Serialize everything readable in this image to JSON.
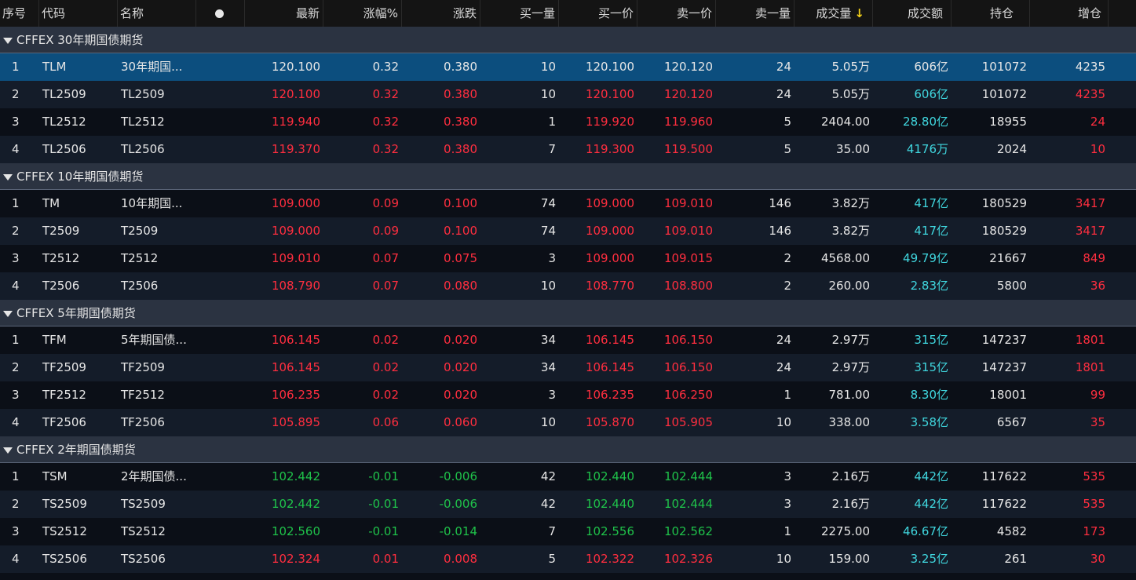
{
  "header": {
    "seq": "序号",
    "code": "代码",
    "name": "名称",
    "latest": "最新",
    "change_pct": "涨幅%",
    "change": "涨跌",
    "bid_vol": "买一量",
    "bid": "买一价",
    "ask": "卖一价",
    "ask_vol": "卖一量",
    "volume": "成交量",
    "sort_arrow": "↓",
    "turnover": "成交额",
    "oi": "持仓",
    "oi_change": "增仓"
  },
  "colors": {
    "up": "#ff2e3f",
    "down": "#1fc24a",
    "turnover": "#40d7df",
    "neutral": "#e6e6e6",
    "selected": "#0c4e7e"
  },
  "groups": [
    {
      "title": "CFFEX 30年期国债期货",
      "rows": [
        {
          "seq": "1",
          "code": "TLM",
          "name": "30年期国...",
          "latest": "120.100",
          "pct": "0.32",
          "chg": "0.380",
          "bidv": "10",
          "bid": "120.100",
          "ask": "120.120",
          "askv": "24",
          "vol": "5.05万",
          "amt": "606亿",
          "oi": "101072",
          "oic": "4235",
          "dir": "up",
          "oidir": "up",
          "selected": true
        },
        {
          "seq": "2",
          "code": "TL2509",
          "name": "TL2509",
          "latest": "120.100",
          "pct": "0.32",
          "chg": "0.380",
          "bidv": "10",
          "bid": "120.100",
          "ask": "120.120",
          "askv": "24",
          "vol": "5.05万",
          "amt": "606亿",
          "oi": "101072",
          "oic": "4235",
          "dir": "up",
          "oidir": "up"
        },
        {
          "seq": "3",
          "code": "TL2512",
          "name": "TL2512",
          "latest": "119.940",
          "pct": "0.32",
          "chg": "0.380",
          "bidv": "1",
          "bid": "119.920",
          "ask": "119.960",
          "askv": "5",
          "vol": "2404.00",
          "amt": "28.80亿",
          "oi": "18955",
          "oic": "24",
          "dir": "up",
          "oidir": "up"
        },
        {
          "seq": "4",
          "code": "TL2506",
          "name": "TL2506",
          "latest": "119.370",
          "pct": "0.32",
          "chg": "0.380",
          "bidv": "7",
          "bid": "119.300",
          "ask": "119.500",
          "askv": "5",
          "vol": "35.00",
          "amt": "4176万",
          "oi": "2024",
          "oic": "10",
          "dir": "up",
          "oidir": "up"
        }
      ]
    },
    {
      "title": "CFFEX 10年期国债期货",
      "rows": [
        {
          "seq": "1",
          "code": "TM",
          "name": "10年期国...",
          "latest": "109.000",
          "pct": "0.09",
          "chg": "0.100",
          "bidv": "74",
          "bid": "109.000",
          "ask": "109.010",
          "askv": "146",
          "vol": "3.82万",
          "amt": "417亿",
          "oi": "180529",
          "oic": "3417",
          "dir": "up",
          "oidir": "up"
        },
        {
          "seq": "2",
          "code": "T2509",
          "name": "T2509",
          "latest": "109.000",
          "pct": "0.09",
          "chg": "0.100",
          "bidv": "74",
          "bid": "109.000",
          "ask": "109.010",
          "askv": "146",
          "vol": "3.82万",
          "amt": "417亿",
          "oi": "180529",
          "oic": "3417",
          "dir": "up",
          "oidir": "up"
        },
        {
          "seq": "3",
          "code": "T2512",
          "name": "T2512",
          "latest": "109.010",
          "pct": "0.07",
          "chg": "0.075",
          "bidv": "3",
          "bid": "109.000",
          "ask": "109.015",
          "askv": "2",
          "vol": "4568.00",
          "amt": "49.79亿",
          "oi": "21667",
          "oic": "849",
          "dir": "up",
          "oidir": "up"
        },
        {
          "seq": "4",
          "code": "T2506",
          "name": "T2506",
          "latest": "108.790",
          "pct": "0.07",
          "chg": "0.080",
          "bidv": "10",
          "bid": "108.770",
          "ask": "108.800",
          "askv": "2",
          "vol": "260.00",
          "amt": "2.83亿",
          "oi": "5800",
          "oic": "36",
          "dir": "up",
          "oidir": "up"
        }
      ]
    },
    {
      "title": "CFFEX 5年期国债期货",
      "rows": [
        {
          "seq": "1",
          "code": "TFM",
          "name": "5年期国债...",
          "latest": "106.145",
          "pct": "0.02",
          "chg": "0.020",
          "bidv": "34",
          "bid": "106.145",
          "ask": "106.150",
          "askv": "24",
          "vol": "2.97万",
          "amt": "315亿",
          "oi": "147237",
          "oic": "1801",
          "dir": "up",
          "oidir": "up"
        },
        {
          "seq": "2",
          "code": "TF2509",
          "name": "TF2509",
          "latest": "106.145",
          "pct": "0.02",
          "chg": "0.020",
          "bidv": "34",
          "bid": "106.145",
          "ask": "106.150",
          "askv": "24",
          "vol": "2.97万",
          "amt": "315亿",
          "oi": "147237",
          "oic": "1801",
          "dir": "up",
          "oidir": "up"
        },
        {
          "seq": "3",
          "code": "TF2512",
          "name": "TF2512",
          "latest": "106.235",
          "pct": "0.02",
          "chg": "0.020",
          "bidv": "3",
          "bid": "106.235",
          "ask": "106.250",
          "askv": "1",
          "vol": "781.00",
          "amt": "8.30亿",
          "oi": "18001",
          "oic": "99",
          "dir": "up",
          "oidir": "up"
        },
        {
          "seq": "4",
          "code": "TF2506",
          "name": "TF2506",
          "latest": "105.895",
          "pct": "0.06",
          "chg": "0.060",
          "bidv": "10",
          "bid": "105.870",
          "ask": "105.905",
          "askv": "10",
          "vol": "338.00",
          "amt": "3.58亿",
          "oi": "6567",
          "oic": "35",
          "dir": "up",
          "oidir": "up"
        }
      ]
    },
    {
      "title": "CFFEX 2年期国债期货",
      "rows": [
        {
          "seq": "1",
          "code": "TSM",
          "name": "2年期国债...",
          "latest": "102.442",
          "pct": "-0.01",
          "chg": "-0.006",
          "bidv": "42",
          "bid": "102.440",
          "ask": "102.444",
          "askv": "3",
          "vol": "2.16万",
          "amt": "442亿",
          "oi": "117622",
          "oic": "535",
          "dir": "down",
          "oidir": "up"
        },
        {
          "seq": "2",
          "code": "TS2509",
          "name": "TS2509",
          "latest": "102.442",
          "pct": "-0.01",
          "chg": "-0.006",
          "bidv": "42",
          "bid": "102.440",
          "ask": "102.444",
          "askv": "3",
          "vol": "2.16万",
          "amt": "442亿",
          "oi": "117622",
          "oic": "535",
          "dir": "down",
          "oidir": "up"
        },
        {
          "seq": "3",
          "code": "TS2512",
          "name": "TS2512",
          "latest": "102.560",
          "pct": "-0.01",
          "chg": "-0.014",
          "bidv": "7",
          "bid": "102.556",
          "ask": "102.562",
          "askv": "1",
          "vol": "2275.00",
          "amt": "46.67亿",
          "oi": "4582",
          "oic": "173",
          "dir": "down",
          "oidir": "up"
        },
        {
          "seq": "4",
          "code": "TS2506",
          "name": "TS2506",
          "latest": "102.324",
          "pct": "0.01",
          "chg": "0.008",
          "bidv": "5",
          "bid": "102.322",
          "ask": "102.326",
          "askv": "10",
          "vol": "159.00",
          "amt": "3.25亿",
          "oi": "261",
          "oic": "30",
          "dir": "up",
          "oidir": "up"
        }
      ]
    }
  ]
}
